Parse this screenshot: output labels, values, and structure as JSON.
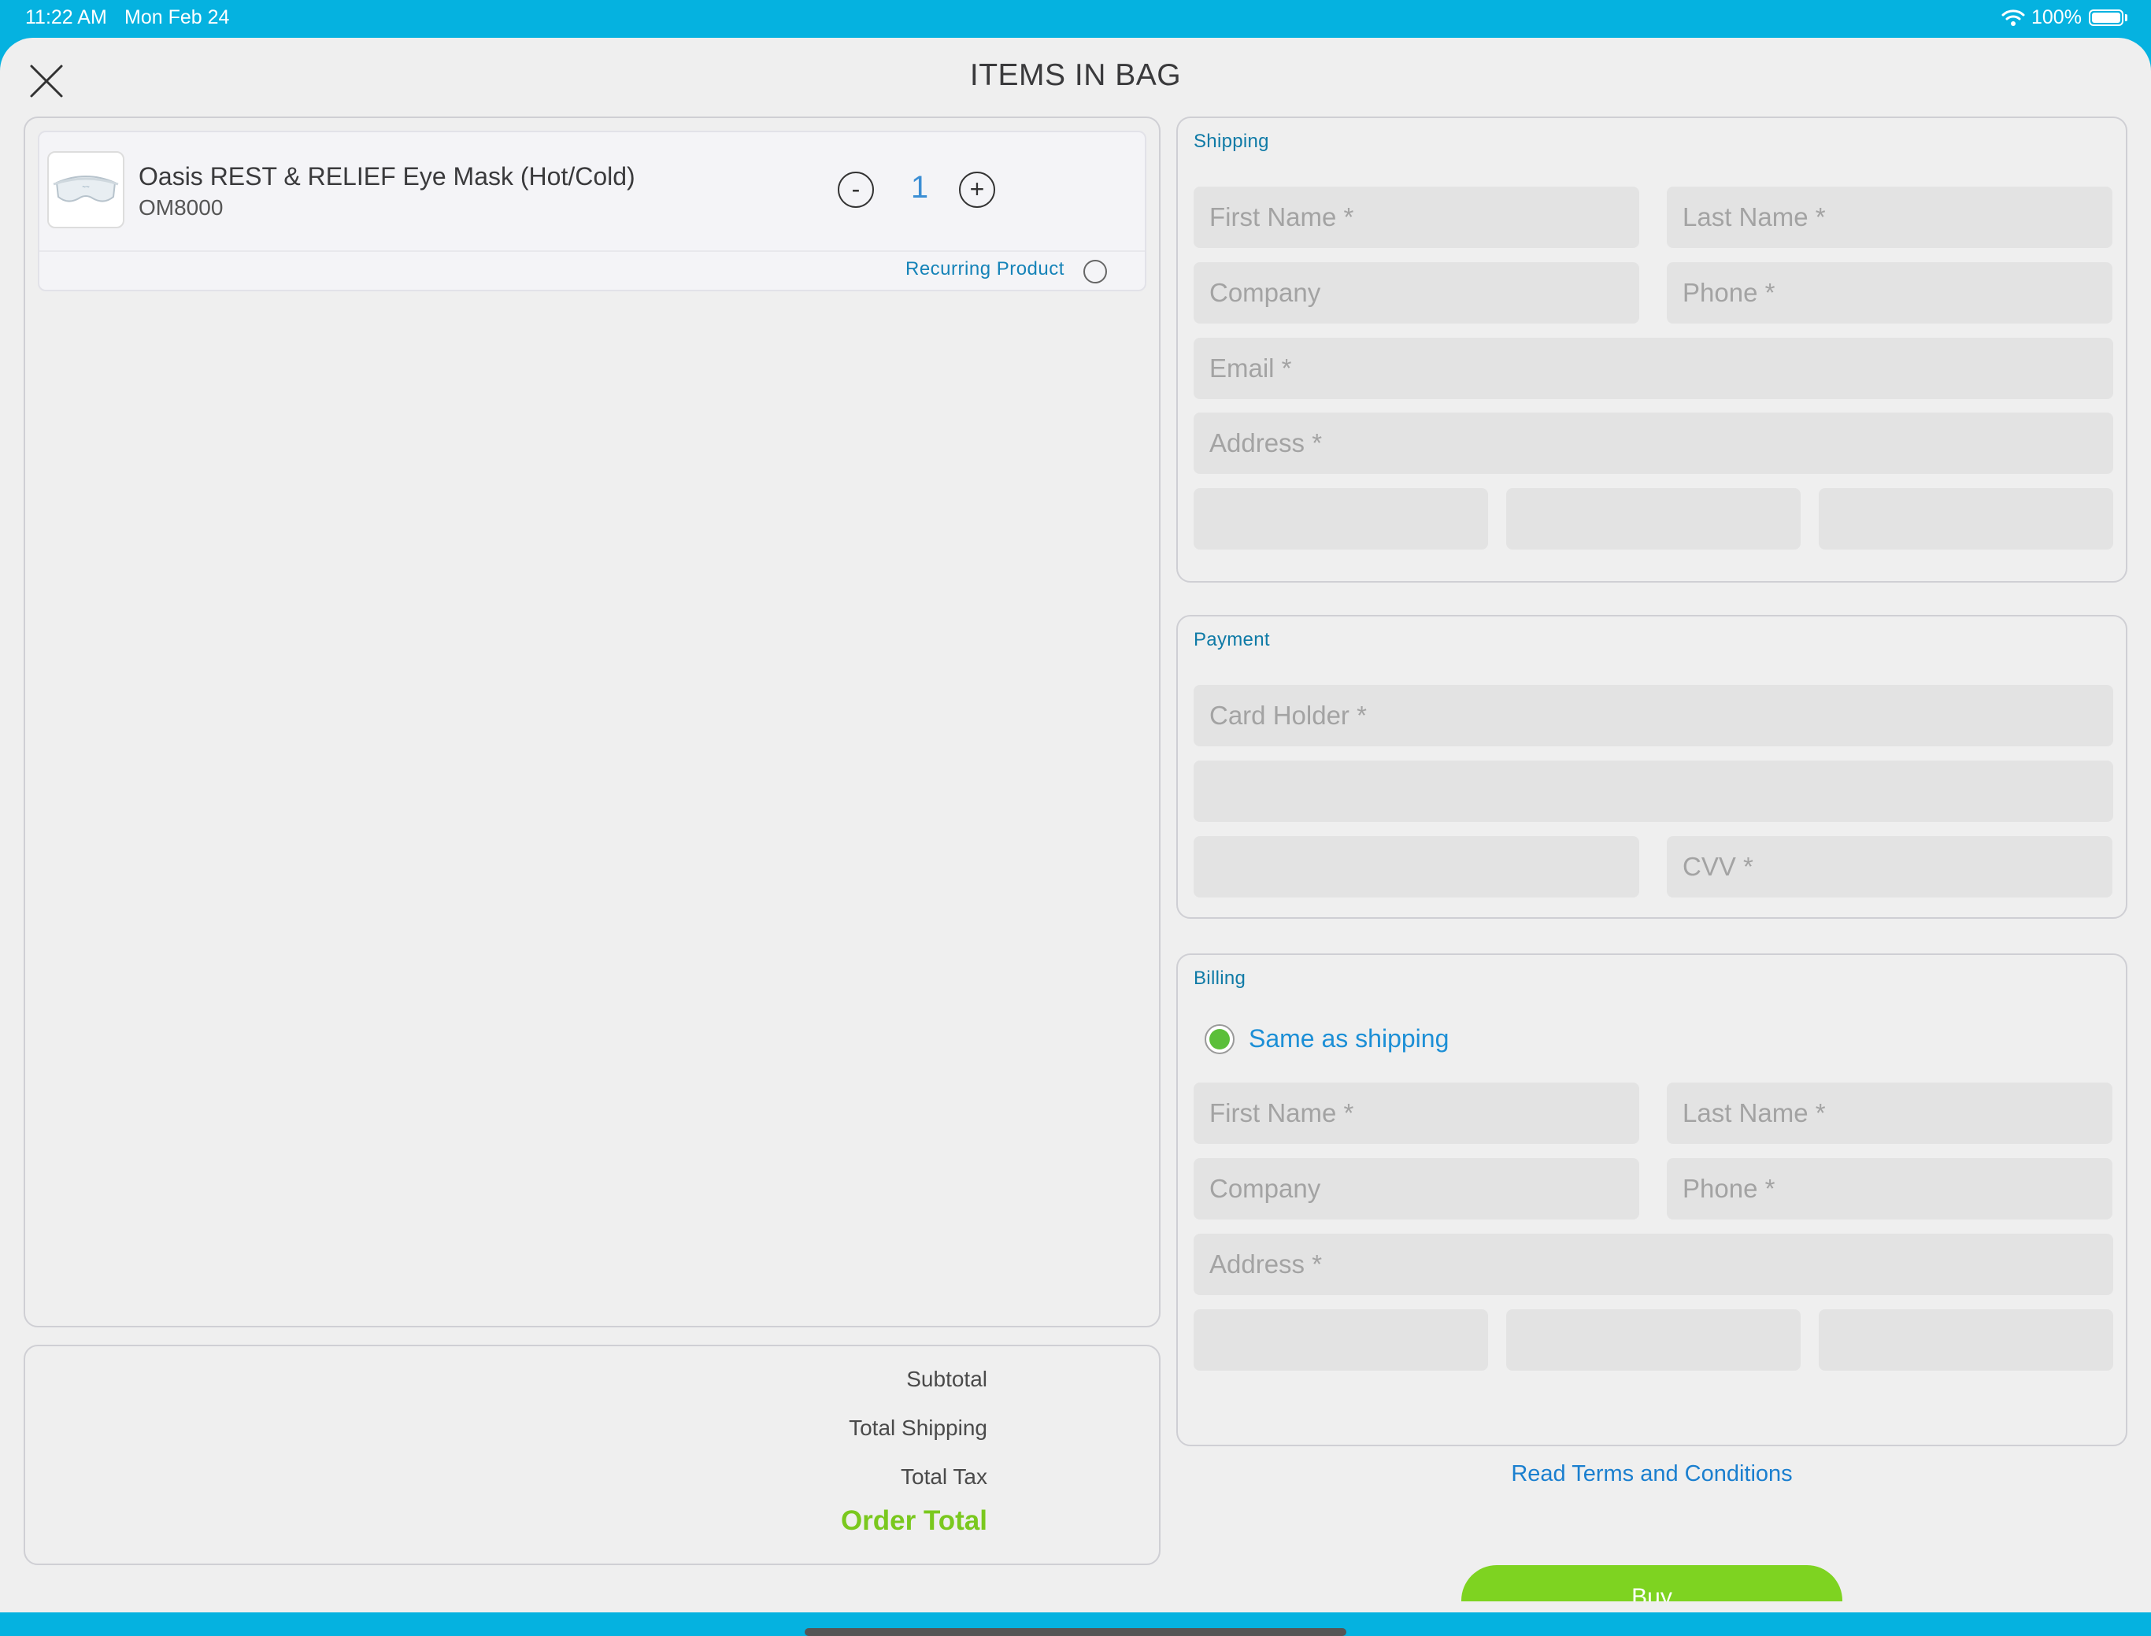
{
  "status_bar": {
    "time": "11:22 AM",
    "date": "Mon Feb 24",
    "battery": "100%",
    "wifi_icon": "wifi-icon",
    "battery_icon": "battery-icon"
  },
  "header": {
    "title": "ITEMS IN BAG",
    "close_icon": "close-icon"
  },
  "bag": {
    "items": [
      {
        "name": "Oasis REST & RELIEF Eye Mask (Hot/Cold)",
        "sku": "OM8000",
        "quantity": "1",
        "decrement_label": "-",
        "increment_label": "+",
        "recurring_label": "Recurring Product",
        "recurring_selected": false
      }
    ]
  },
  "totals": {
    "subtotal_label": "Subtotal",
    "shipping_label": "Total Shipping",
    "tax_label": "Total Tax",
    "order_total_label": "Order Total"
  },
  "shipping": {
    "title": "Shipping",
    "first_name_placeholder": "First Name *",
    "last_name_placeholder": "Last Name *",
    "company_placeholder": "Company",
    "phone_placeholder": "Phone *",
    "email_placeholder": "Email *",
    "address_placeholder": "Address *",
    "city_placeholder": "",
    "state_placeholder": "",
    "zip_placeholder": ""
  },
  "payment": {
    "title": "Payment",
    "card_holder_placeholder": "Card Holder *",
    "card_number_placeholder": "",
    "expiry_placeholder": "",
    "cvv_placeholder": "CVV *"
  },
  "billing": {
    "title": "Billing",
    "same_as_shipping_label": "Same as shipping",
    "same_as_shipping_selected": true,
    "first_name_placeholder": "First Name *",
    "last_name_placeholder": "Last Name *",
    "company_placeholder": "Company",
    "phone_placeholder": "Phone *",
    "address_placeholder": "Address *",
    "city_placeholder": "",
    "state_placeholder": "",
    "zip_placeholder": ""
  },
  "footer": {
    "terms_label": "Read Terms and Conditions",
    "buy_label": "Buy"
  },
  "colors": {
    "status_bar": "#05b2e0",
    "accent_blue": "#1c8fd6",
    "accent_green": "#7ed321",
    "order_total": "#7ac81e",
    "section_title": "#0e7aa6"
  }
}
